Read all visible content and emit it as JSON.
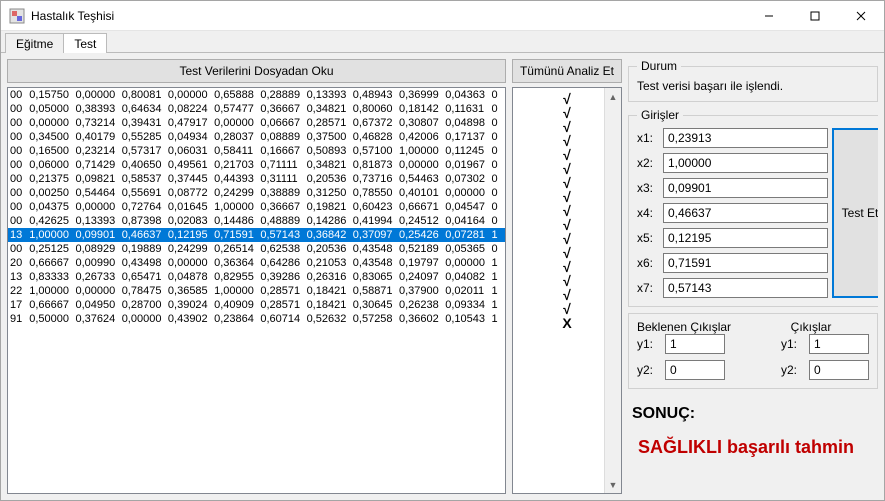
{
  "window": {
    "title": "Hastalık Teşhisi"
  },
  "tabs": {
    "train": "Eğitme",
    "test": "Test"
  },
  "buttons": {
    "readTestFile": "Test Verilerini Dosyadan Oku",
    "analyzeAll": "Tümünü Analiz Et",
    "testEt": "Test Et"
  },
  "status": {
    "legend": "Durum",
    "text": "Test verisi başarı ile işlendi."
  },
  "inputs": {
    "legend": "Girişler",
    "labels": {
      "x1": "x1:",
      "x2": "x2:",
      "x3": "x3:",
      "x4": "x4:",
      "x5": "x5:",
      "x6": "x6:",
      "x7": "x7:"
    },
    "values": {
      "x1": "0,23913",
      "x2": "1,00000",
      "x3": "0,09901",
      "x4": "0,46637",
      "x5": "0,12195",
      "x6": "0,71591",
      "x7": "0,57143"
    }
  },
  "outputs": {
    "expectedLegend": "Beklenen Çıkışlar",
    "outputsLegend": "Çıkışlar",
    "labels": {
      "y1": "y1:",
      "y2": "y2:"
    },
    "expected": {
      "y1": "1",
      "y2": "0"
    },
    "actual": {
      "y1": "1",
      "y2": "0"
    }
  },
  "result": {
    "label": "SONUÇ:",
    "value": "SAĞLIKLI başarılı tahmin"
  },
  "gridSelectedIndex": 10,
  "grid": [
    {
      "id": "00",
      "v": [
        "0,15750",
        "0,00000",
        "0,80081",
        "0,00000",
        "0,65888",
        "0,28889",
        "0,13393",
        "0,48943",
        "0,36999",
        "0,04363"
      ],
      "flag": "0"
    },
    {
      "id": "00",
      "v": [
        "0,05000",
        "0,38393",
        "0,64634",
        "0,08224",
        "0,57477",
        "0,36667",
        "0,34821",
        "0,80060",
        "0,18142",
        "0,11631"
      ],
      "flag": "0"
    },
    {
      "id": "00",
      "v": [
        "0,00000",
        "0,73214",
        "0,39431",
        "0,47917",
        "0,00000",
        "0,06667",
        "0,28571",
        "0,67372",
        "0,30807",
        "0,04898"
      ],
      "flag": "0"
    },
    {
      "id": "00",
      "v": [
        "0,34500",
        "0,40179",
        "0,55285",
        "0,04934",
        "0,28037",
        "0,08889",
        "0,37500",
        "0,46828",
        "0,42006",
        "0,17137"
      ],
      "flag": "0"
    },
    {
      "id": "00",
      "v": [
        "0,16500",
        "0,23214",
        "0,57317",
        "0,06031",
        "0,58411",
        "0,16667",
        "0,50893",
        "0,57100",
        "1,00000",
        "0,11245"
      ],
      "flag": "0"
    },
    {
      "id": "00",
      "v": [
        "0,06000",
        "0,71429",
        "0,40650",
        "0,49561",
        "0,21703",
        "0,71111",
        "0,34821",
        "0,81873",
        "0,00000",
        "0,01967"
      ],
      "flag": "0"
    },
    {
      "id": "00",
      "v": [
        "0,21375",
        "0,09821",
        "0,58537",
        "0,37445",
        "0,44393",
        "0,31111",
        "0,20536",
        "0,73716",
        "0,54463",
        "0,07302"
      ],
      "flag": "0"
    },
    {
      "id": "00",
      "v": [
        "0,00250",
        "0,54464",
        "0,55691",
        "0,08772",
        "0,24299",
        "0,38889",
        "0,31250",
        "0,78550",
        "0,40101",
        "0,00000"
      ],
      "flag": "0"
    },
    {
      "id": "00",
      "v": [
        "0,04375",
        "0,00000",
        "0,72764",
        "0,01645",
        "1,00000",
        "0,36667",
        "0,19821",
        "0,60423",
        "0,66671",
        "0,04547"
      ],
      "flag": "0"
    },
    {
      "id": "00",
      "v": [
        "0,42625",
        "0,13393",
        "0,87398",
        "0,02083",
        "0,14486",
        "0,48889",
        "0,14286",
        "0,41994",
        "0,24512",
        "0,04164"
      ],
      "flag": "0"
    },
    {
      "id": "13",
      "v": [
        "1,00000",
        "0,09901",
        "0,46637",
        "0,12195",
        "0,71591",
        "0,57143",
        "0,36842",
        "0,37097",
        "0,25426",
        "0,07281"
      ],
      "flag": "1"
    },
    {
      "id": "00",
      "v": [
        "0,25125",
        "0,08929",
        "0,19889",
        "0,24299",
        "0,26514",
        "0,62538",
        "0,20536",
        "0,43548",
        "0,52189",
        "0,05365"
      ],
      "flag": "0"
    },
    {
      "id": "20",
      "v": [
        "0,66667",
        "0,00990",
        "0,43498",
        "0,00000",
        "0,36364",
        "0,64286",
        "0,21053",
        "0,43548",
        "0,19797",
        "0,00000"
      ],
      "flag": "1"
    },
    {
      "id": "13",
      "v": [
        "0,83333",
        "0,26733",
        "0,65471",
        "0,04878",
        "0,82955",
        "0,39286",
        "0,26316",
        "0,83065",
        "0,24097",
        "0,04082"
      ],
      "flag": "1"
    },
    {
      "id": "22",
      "v": [
        "1,00000",
        "0,00000",
        "0,78475",
        "0,36585",
        "1,00000",
        "0,28571",
        "0,18421",
        "0,58871",
        "0,37900",
        "0,02011"
      ],
      "flag": "1"
    },
    {
      "id": "17",
      "v": [
        "0,66667",
        "0,04950",
        "0,28700",
        "0,39024",
        "0,40909",
        "0,28571",
        "0,18421",
        "0,30645",
        "0,26238",
        "0,09334"
      ],
      "flag": "1"
    },
    {
      "id": "91",
      "v": [
        "0,50000",
        "0,37624",
        "0,00000",
        "0,43902",
        "0,23864",
        "0,60714",
        "0,52632",
        "0,57258",
        "0,36602",
        "0,10543"
      ],
      "flag": "1"
    }
  ],
  "checks": [
    "√",
    "√",
    "√",
    "√",
    "√",
    "√",
    "√",
    "√",
    "√",
    "√",
    "√",
    "√",
    "√",
    "√",
    "√",
    "√",
    "X"
  ]
}
